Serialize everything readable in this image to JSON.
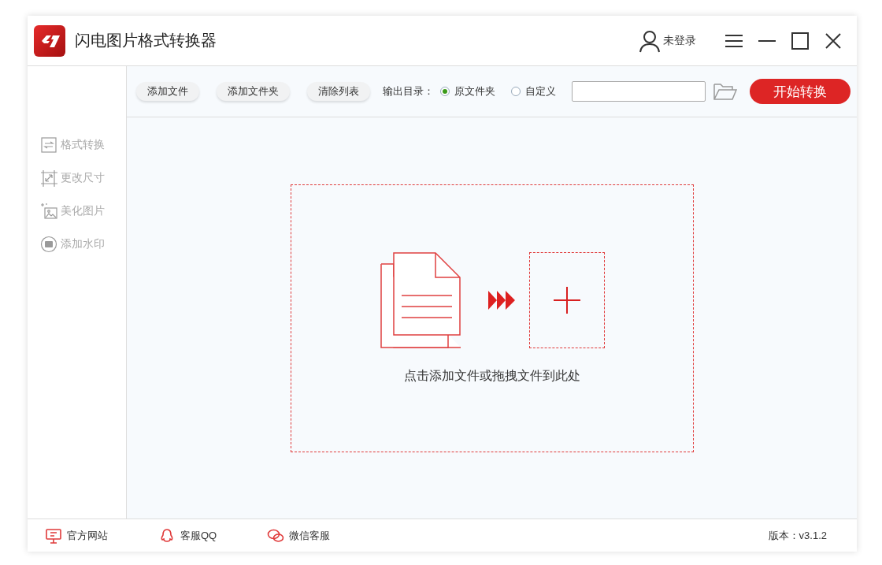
{
  "window": {
    "title": "闪电图片格式转换器",
    "user": "未登录"
  },
  "sidebar": {
    "items": [
      {
        "label": "格式转换",
        "kind": "convert"
      },
      {
        "label": "更改尺寸",
        "kind": "resize"
      },
      {
        "label": "美化图片",
        "kind": "beautify"
      },
      {
        "label": "添加水印",
        "kind": "watermark"
      }
    ]
  },
  "toolbar": {
    "buttons": [
      "添加文件",
      "添加文件夹",
      "清除列表"
    ],
    "output_label": "输出目录：",
    "output_options": [
      {
        "label": "原文件夹",
        "selected": true
      },
      {
        "label": "自定义",
        "selected": false
      }
    ],
    "start_button": "开始转换"
  },
  "drop_zone": {
    "hint": "点击添加文件或拖拽文件到此处"
  },
  "status_bar": {
    "links": [
      {
        "label": "官方网站",
        "kind": "website"
      },
      {
        "label": "客服QQ",
        "kind": "qq"
      },
      {
        "label": "微信客服",
        "kind": "wechat"
      }
    ],
    "version": "版本：v3.1.2"
  }
}
